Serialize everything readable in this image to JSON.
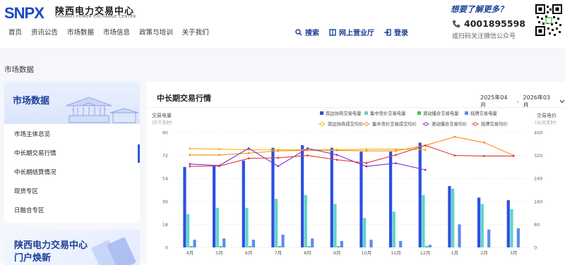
{
  "logo": {
    "mark": "SNPX",
    "cn": "陕西电力交易中心",
    "en": "SHAANXI POWER EXCHANGE CENTER"
  },
  "nav": [
    "首页",
    "资讯公告",
    "市场数据",
    "市场信息",
    "政策与培训",
    "关于我们"
  ],
  "toolbar": {
    "search": "搜索",
    "hall": "网上营业厅",
    "login": "登录"
  },
  "hotline": {
    "question": "想要了解更多？",
    "phone": "4001895598",
    "sub": "或扫码关注微信公众号"
  },
  "breadcrumb": "市场数据",
  "sidebar": {
    "title": "市场数据",
    "items": [
      "市场主体总览",
      "中长期交易行情",
      "中长期结算情况",
      "现货专区",
      "日融合专区"
    ],
    "active": 1
  },
  "promo": {
    "line1": "陕西电力交易中心",
    "line2": "门户焕新"
  },
  "main": {
    "title": "中长期交易行情",
    "date_start": "2025年04月",
    "date_sep": "-",
    "date_end": "2026年03月"
  },
  "chart_data": {
    "type": "bar",
    "left_axis": {
      "label": "交易电量",
      "unit": "(亿千瓦时)",
      "ticks": [
        0,
        18,
        36,
        54,
        72,
        90
      ],
      "ylim": [
        0,
        90
      ]
    },
    "right_axis": {
      "label": "交易电价",
      "unit": "(元/兆瓦时)",
      "ticks": [
        0,
        80,
        160,
        240,
        320,
        400
      ],
      "ylim": [
        0,
        400
      ]
    },
    "categories": [
      "4月",
      "5月",
      "6月",
      "7月",
      "8月",
      "9月",
      "10月",
      "11月",
      "12月",
      "1月",
      "2月",
      "3月"
    ],
    "bar_series": [
      {
        "name": "双边协商交易电量",
        "color": "#2d4fe0",
        "values": [
          63,
          64,
          68,
          78,
          80,
          78,
          75,
          75,
          82,
          48,
          39,
          37
        ]
      },
      {
        "name": "集中竞价交易电量",
        "color": "#5fd4cc",
        "values": [
          26,
          31,
          31,
          38,
          41,
          34,
          23,
          28,
          41,
          46,
          34,
          30
        ]
      },
      {
        "name": "滚动撮合交易电量",
        "color": "#3cc84a",
        "values": [
          1,
          1,
          1,
          1,
          1,
          1,
          0,
          0,
          1,
          0,
          0,
          0
        ]
      },
      {
        "name": "挂牌交易电量",
        "color": "#5b8def",
        "values": [
          6,
          7,
          6,
          10,
          7,
          5,
          6,
          5,
          2,
          18,
          14,
          15
        ]
      }
    ],
    "line_series": [
      {
        "name": "双边协商成交均价",
        "color": "#f5b400",
        "values": [
          344,
          342,
          340,
          340,
          340,
          340,
          342,
          342,
          340,
          null,
          null,
          null
        ]
      },
      {
        "name": "集中竞价交易成交均价",
        "color": "#f5901e",
        "values": [
          322,
          322,
          328,
          336,
          338,
          338,
          336,
          336,
          355,
          385,
          365,
          320
        ]
      },
      {
        "name": "滚动撮合交易均价",
        "color": "#7e2fd6",
        "values": [
          290,
          285,
          345,
          283,
          345,
          322,
          282,
          293,
          270,
          null,
          null,
          null
        ]
      },
      {
        "name": "挂牌交易均价",
        "color": "#e23b3b",
        "values": [
          282,
          283,
          310,
          312,
          320,
          305,
          294,
          322,
          355,
          320,
          318,
          318
        ]
      }
    ]
  }
}
